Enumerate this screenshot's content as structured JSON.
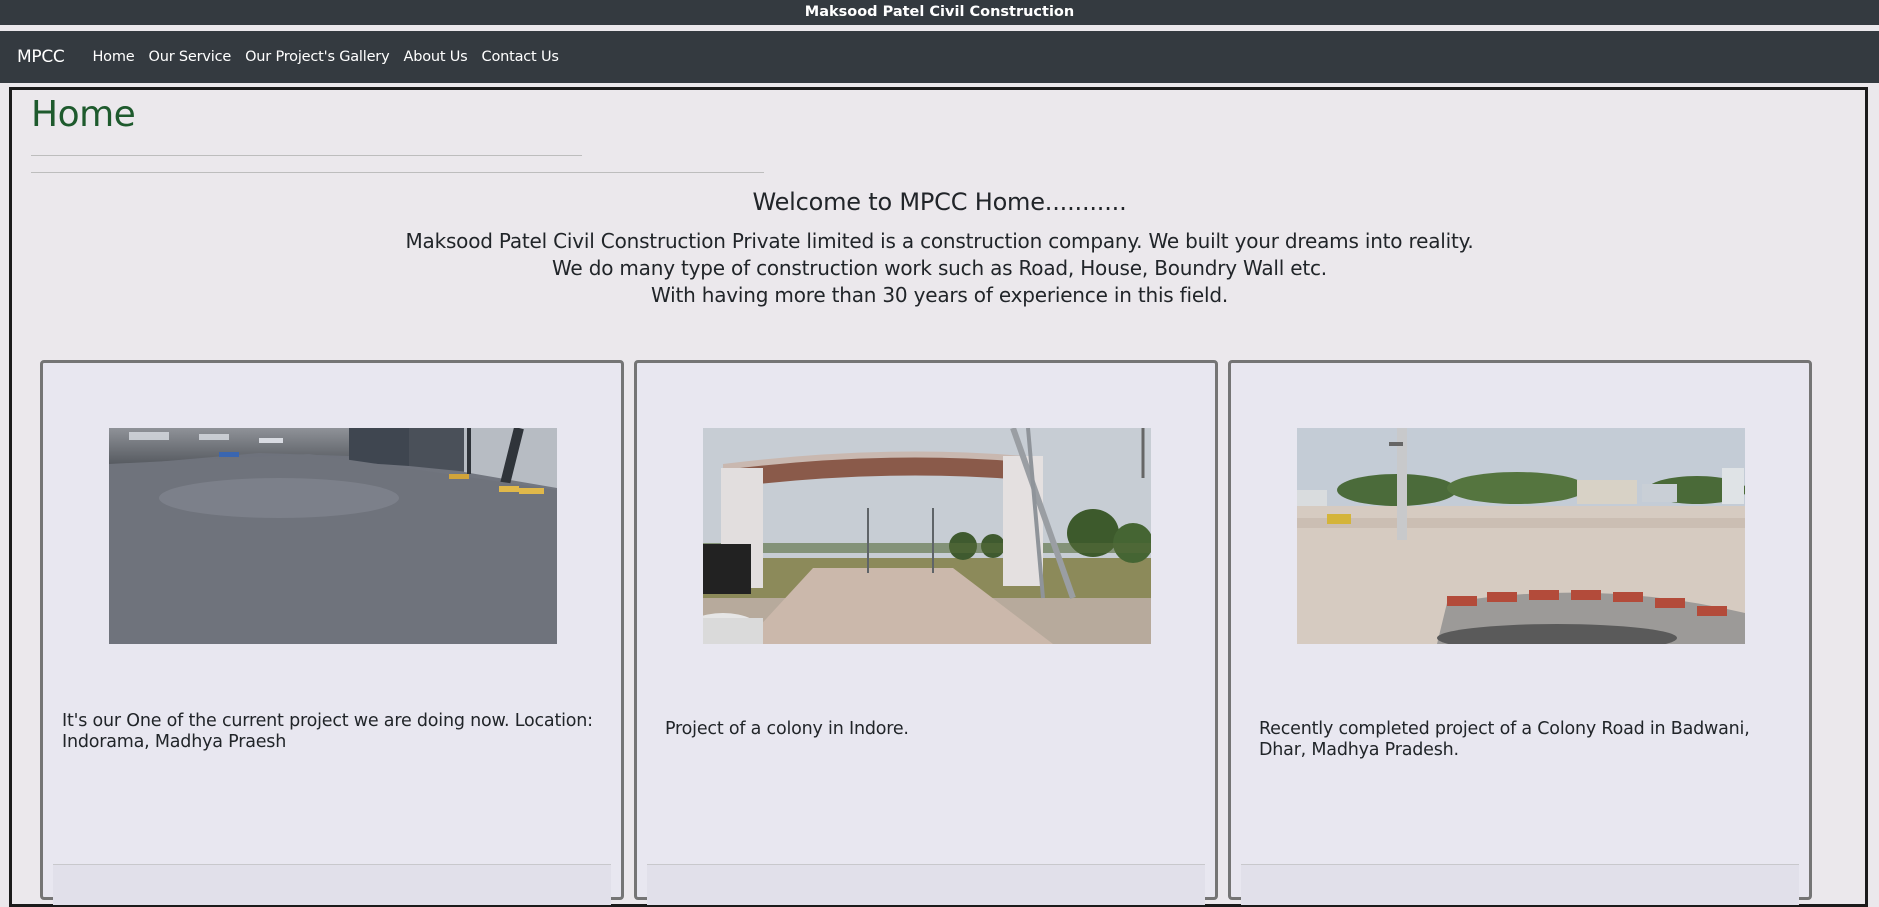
{
  "site": {
    "banner_title": "Maksood Patel Civil Construction"
  },
  "navbar": {
    "brand": "MPCC",
    "links": [
      "Home",
      "Our Service",
      "Our Project's Gallery",
      "About Us",
      "Contact Us"
    ]
  },
  "main": {
    "page_title": "Home",
    "welcome_heading": "Welcome to MPCC Home...........",
    "intro_lines": [
      "Maksood Patel Civil Construction Private limited is a construction company. We built your dreams into reality.",
      "We do many type of construction work such as Road, House, Boundry Wall etc.",
      "With having more than 30 years of experience in this field."
    ],
    "cards": [
      {
        "image": "warehouse-concrete-floor-photo",
        "caption": "It's our One of the current project we are doing now. Location: Indorama, Madhya Praesh"
      },
      {
        "image": "colony-entrance-gate-photo",
        "caption": "Project of a colony in Indore."
      },
      {
        "image": "colony-road-photo",
        "caption": "Recently completed project of a Colony Road in Badwani, Dhar, Madhya Pradesh."
      }
    ]
  },
  "colors": {
    "navbar_bg": "#343a40",
    "page_bg": "#ebe8ec",
    "title_green": "#1e5a2d",
    "card_bg": "#e8e7f0",
    "card_border": "#757575"
  }
}
